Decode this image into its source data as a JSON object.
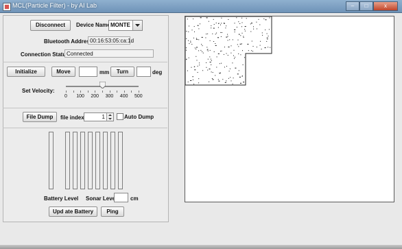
{
  "window": {
    "title": "MCL(Particle Filter) - by AI Lab",
    "min": "–",
    "max": "□",
    "close": "x"
  },
  "connection": {
    "disconnect_label": "Disconnect",
    "device_name_label": "Device Name",
    "device_name_value": "MONTE",
    "bt_address_label": "Bluetooth Address",
    "bt_address_value": "00:16:53:05:ca:1d",
    "status_label": "Connection Status:",
    "status_value": "Connected"
  },
  "motion": {
    "initialize_label": "Initialize",
    "move_label": "Move",
    "move_value": "",
    "mm_label": "mm",
    "turn_label": "Turn",
    "turn_value": "",
    "deg_label": "deg",
    "velocity_label": "Set Velocity:",
    "velocity_value": 250,
    "velocity_ticks": [
      "0",
      "100",
      "200",
      "300",
      "400",
      "500"
    ]
  },
  "dump": {
    "file_dump_label": "File Dump",
    "file_index_label": "file index",
    "file_index_value": "1",
    "auto_dump_label": "Auto Dump",
    "auto_dump_checked": false
  },
  "sensors": {
    "battery_level_label": "Battery Level",
    "sonar_level_label": "Sonar Level",
    "sonar_value": "",
    "cm_label": "cm",
    "update_battery_label": "Upd ate Battery",
    "ping_label": "Ping",
    "bar_count": 9
  }
}
